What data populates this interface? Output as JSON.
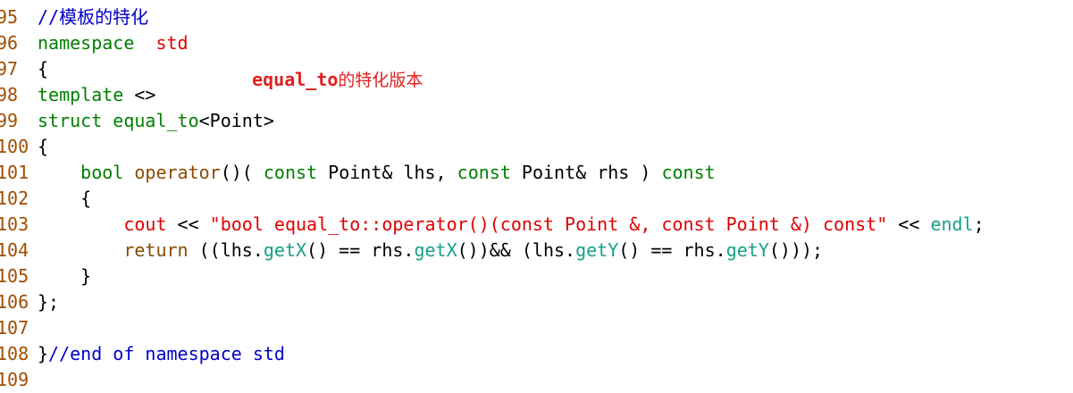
{
  "editor": {
    "lines": [
      {
        "number": "95",
        "segments": [
          {
            "text": "//模板的特化",
            "cls": "comment"
          }
        ]
      },
      {
        "number": "96",
        "segments": [
          {
            "text": "namespace",
            "cls": "kw-green"
          },
          {
            "text": "  ",
            "cls": "dark"
          },
          {
            "text": "std",
            "cls": "red"
          }
        ]
      },
      {
        "number": "97",
        "segments": [
          {
            "text": "{",
            "cls": "dark"
          }
        ]
      },
      {
        "number": "98",
        "segments": [
          {
            "text": "template",
            "cls": "kw-green"
          },
          {
            "text": " <>",
            "cls": "dark"
          }
        ]
      },
      {
        "number": "99",
        "segments": [
          {
            "text": "struct",
            "cls": "kw-green"
          },
          {
            "text": " ",
            "cls": "dark"
          },
          {
            "text": "equal_to",
            "cls": "kw-green"
          },
          {
            "text": "<Point>",
            "cls": "dark"
          }
        ]
      },
      {
        "number": "100",
        "segments": [
          {
            "text": "{",
            "cls": "dark"
          }
        ]
      },
      {
        "number": "101",
        "segments": [
          {
            "text": "    ",
            "cls": "dark"
          },
          {
            "text": "bool",
            "cls": "kw-green"
          },
          {
            "text": " ",
            "cls": "dark"
          },
          {
            "text": "operator",
            "cls": "kw-brown"
          },
          {
            "text": "()( ",
            "cls": "dark"
          },
          {
            "text": "const",
            "cls": "kw-green"
          },
          {
            "text": " Point& lhs, ",
            "cls": "dark"
          },
          {
            "text": "const",
            "cls": "kw-green"
          },
          {
            "text": " Point& rhs ) ",
            "cls": "dark"
          },
          {
            "text": "const",
            "cls": "kw-green"
          }
        ]
      },
      {
        "number": "102",
        "segments": [
          {
            "text": "    {",
            "cls": "dark"
          }
        ]
      },
      {
        "number": "103",
        "segments": [
          {
            "text": "        ",
            "cls": "dark"
          },
          {
            "text": "cout",
            "cls": "red"
          },
          {
            "text": " << ",
            "cls": "dark"
          },
          {
            "text": "\"bool equal_to::operator()(const Point &, const Point &) const\"",
            "cls": "red"
          },
          {
            "text": " << ",
            "cls": "dark"
          },
          {
            "text": "endl",
            "cls": "kw-teal"
          },
          {
            "text": ";",
            "cls": "dark"
          }
        ]
      },
      {
        "number": "104",
        "segments": [
          {
            "text": "        ",
            "cls": "dark"
          },
          {
            "text": "return",
            "cls": "kw-brown"
          },
          {
            "text": " ((lhs.",
            "cls": "dark"
          },
          {
            "text": "getX",
            "cls": "kw-teal"
          },
          {
            "text": "() == rhs.",
            "cls": "dark"
          },
          {
            "text": "getX",
            "cls": "kw-teal"
          },
          {
            "text": "())&& (lhs.",
            "cls": "dark"
          },
          {
            "text": "getY",
            "cls": "kw-teal"
          },
          {
            "text": "() == rhs.",
            "cls": "dark"
          },
          {
            "text": "getY",
            "cls": "kw-teal"
          },
          {
            "text": "()));",
            "cls": "dark"
          }
        ]
      },
      {
        "number": "105",
        "segments": [
          {
            "text": "    }",
            "cls": "dark"
          }
        ]
      },
      {
        "number": "106",
        "segments": [
          {
            "text": "};",
            "cls": "dark"
          }
        ]
      },
      {
        "number": "107",
        "segments": []
      },
      {
        "number": "108",
        "segments": [
          {
            "text": "}",
            "cls": "dark"
          },
          {
            "text": "//end of namespace std",
            "cls": "comment"
          }
        ]
      },
      {
        "number": "109",
        "segments": []
      }
    ]
  },
  "annotation": {
    "code_part": "equal_to",
    "cn_part": "的特化版本"
  },
  "colors": {
    "line_number": "#a04d00",
    "keyword_green": "#008000",
    "keyword_brown": "#8a4a00",
    "identifier_teal": "#17a086",
    "string_red": "#e00000",
    "comment_blue": "#0000c8",
    "annotation_red": "#e02020"
  }
}
